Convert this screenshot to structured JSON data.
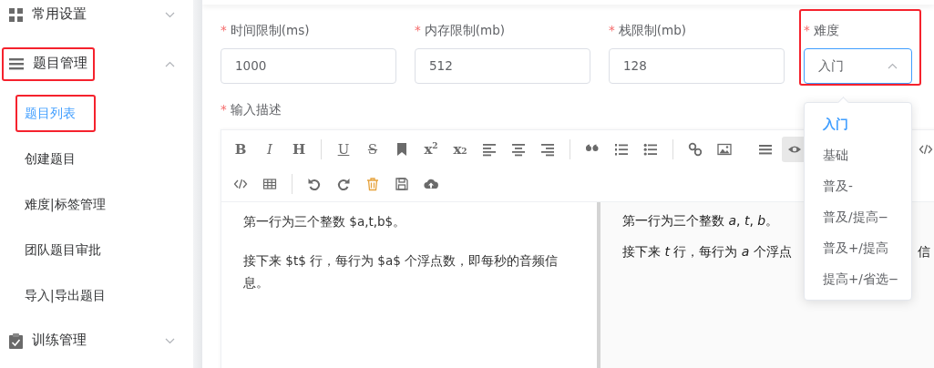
{
  "sidebar": {
    "items": [
      {
        "label": "常用设置",
        "kind": "grid",
        "expanded": false,
        "highlighted": false
      },
      {
        "label": "题目管理",
        "kind": "menu",
        "expanded": true,
        "highlighted": true,
        "children": [
          {
            "label": "题目列表",
            "selected": true,
            "highlighted": true
          },
          {
            "label": "创建题目",
            "selected": false,
            "highlighted": false
          },
          {
            "label": "难度|标签管理",
            "selected": false,
            "highlighted": false
          },
          {
            "label": "团队题目审批",
            "selected": false,
            "highlighted": false
          },
          {
            "label": "导入|导出题目",
            "selected": false,
            "highlighted": false
          }
        ]
      },
      {
        "label": "训练管理",
        "kind": "clipboard",
        "expanded": false,
        "highlighted": false
      }
    ]
  },
  "form": {
    "fields": [
      {
        "kind": "input",
        "label": "时间限制(ms)",
        "required_mark": "*",
        "value": "1000"
      },
      {
        "kind": "input",
        "label": "内存限制(mb)",
        "required_mark": "*",
        "value": "512"
      },
      {
        "kind": "input",
        "label": "栈限制(mb)",
        "required_mark": "*",
        "value": "128"
      },
      {
        "kind": "select",
        "label": "难度",
        "required_mark": "*",
        "value": "入门",
        "expanded": true,
        "highlighted": true,
        "options": [
          {
            "label": "入门",
            "selected": true
          },
          {
            "label": "基础",
            "selected": false
          },
          {
            "label": "普及-",
            "selected": false
          },
          {
            "label": "普及/提高−",
            "selected": false
          },
          {
            "label": "普及+/提高",
            "selected": false
          },
          {
            "label": "提高+/省选−",
            "selected": false
          }
        ]
      }
    ],
    "description": {
      "label": "输入描述",
      "required_mark": "*",
      "toolbar": {
        "left": [
          [
            {
              "kind": "glyph",
              "text": "B",
              "selected": false
            },
            {
              "kind": "glyph",
              "text": "I",
              "selected": false
            },
            {
              "kind": "glyph",
              "text": "H",
              "selected": false
            },
            {
              "kind": "separator"
            },
            {
              "kind": "glyph",
              "text": "U",
              "selected": false
            },
            {
              "kind": "glyph",
              "text": "S",
              "selected": false
            },
            {
              "kind": "bookmark",
              "selected": false
            },
            {
              "kind": "glyph",
              "text": "x$^{2}$",
              "selected": false
            },
            {
              "kind": "glyph",
              "text": "x$_{2}$",
              "selected": false
            },
            {
              "kind": "align-left",
              "selected": false
            },
            {
              "kind": "align-center",
              "selected": false
            },
            {
              "kind": "align-right",
              "selected": false
            },
            {
              "kind": "separator"
            },
            {
              "kind": "quote",
              "selected": false
            },
            {
              "kind": "ordered",
              "selected": false
            },
            {
              "kind": "bullets",
              "selected": false
            },
            {
              "kind": "separator"
            },
            {
              "kind": "link",
              "selected": false
            },
            {
              "kind": "image",
              "selected": false
            }
          ],
          [
            {
              "kind": "code",
              "selected": false
            },
            {
              "kind": "table",
              "selected": false
            },
            {
              "kind": "separator"
            },
            {
              "kind": "undo",
              "selected": false
            },
            {
              "kind": "redo",
              "selected": false
            },
            {
              "kind": "trash",
              "selected": false
            },
            {
              "kind": "save",
              "selected": false
            },
            {
              "kind": "upload",
              "selected": false
            }
          ]
        ],
        "right": [
          {
            "kind": "menu",
            "selected": false
          },
          {
            "kind": "eye",
            "selected": true
          },
          {
            "kind": "code",
            "selected": false
          }
        ]
      },
      "source": [
        "第一行为三个整数 $a,t,b$。",
        "接下来 $t$ 行，每行为 $a$ 个浮点数，即每秒的音频信息。"
      ],
      "preview": [
        [
          "第一行为三个整数 *a*, *t*, *b*。"
        ],
        [
          "接下来 *t* 行，每行为 *a* 个浮点",
          "信"
        ]
      ]
    }
  }
}
